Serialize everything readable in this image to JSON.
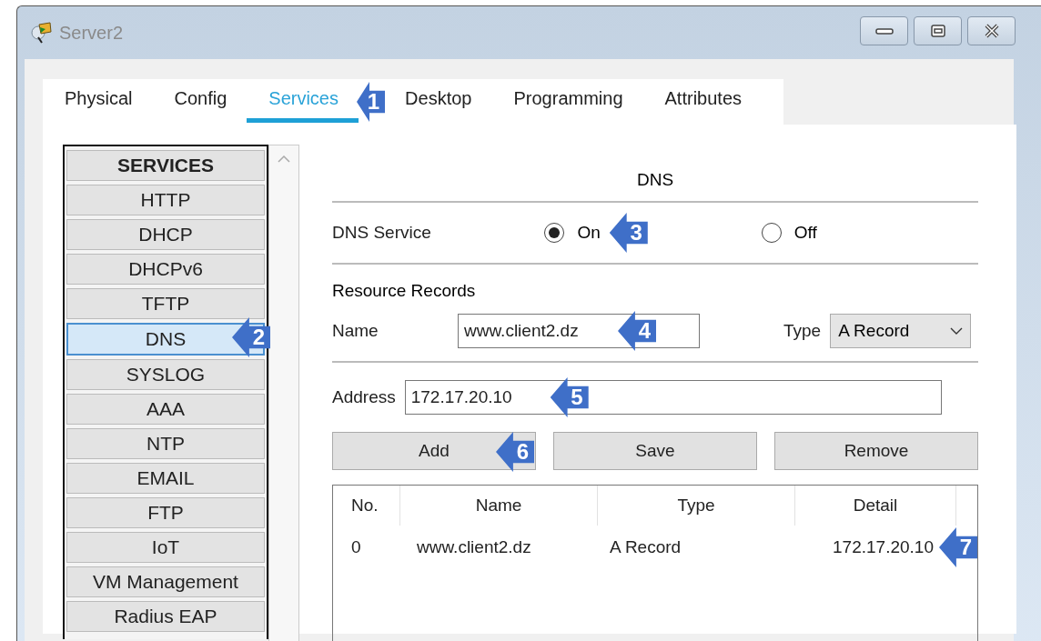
{
  "window": {
    "title": "Server2"
  },
  "tabs": [
    {
      "label": "Physical",
      "selected": false
    },
    {
      "label": "Config",
      "selected": false
    },
    {
      "label": "Services",
      "selected": true,
      "callout": "1"
    },
    {
      "label": "Desktop",
      "selected": false
    },
    {
      "label": "Programming",
      "selected": false
    },
    {
      "label": "Attributes",
      "selected": false
    }
  ],
  "sidebar": {
    "header": "SERVICES",
    "items": [
      {
        "label": "HTTP",
        "selected": false
      },
      {
        "label": "DHCP",
        "selected": false
      },
      {
        "label": "DHCPv6",
        "selected": false
      },
      {
        "label": "TFTP",
        "selected": false
      },
      {
        "label": "DNS",
        "selected": true,
        "callout": "2"
      },
      {
        "label": "SYSLOG",
        "selected": false
      },
      {
        "label": "AAA",
        "selected": false
      },
      {
        "label": "NTP",
        "selected": false
      },
      {
        "label": "EMAIL",
        "selected": false
      },
      {
        "label": "FTP",
        "selected": false
      },
      {
        "label": "IoT",
        "selected": false
      },
      {
        "label": "VM Management",
        "selected": false
      },
      {
        "label": "Radius EAP",
        "selected": false
      }
    ]
  },
  "dns": {
    "title": "DNS",
    "service_label": "DNS Service",
    "options": [
      {
        "label": "On",
        "selected": true,
        "callout": "3"
      },
      {
        "label": "Off",
        "selected": false
      }
    ],
    "records_label": "Resource Records",
    "name_label": "Name",
    "name_value": "www.client2.dz",
    "name_callout": "4",
    "type_label": "Type",
    "type_value": "A Record",
    "address_label": "Address",
    "address_value": "172.17.20.10",
    "address_callout": "5",
    "buttons": [
      {
        "label": "Add",
        "callout": "6"
      },
      {
        "label": "Save"
      },
      {
        "label": "Remove"
      }
    ],
    "table": {
      "columns": [
        "No.",
        "Name",
        "Type",
        "Detail"
      ],
      "rows": [
        {
          "cells": [
            "0",
            "www.client2.dz",
            "A Record",
            "172.17.20.10"
          ],
          "callout": "7"
        }
      ]
    }
  }
}
